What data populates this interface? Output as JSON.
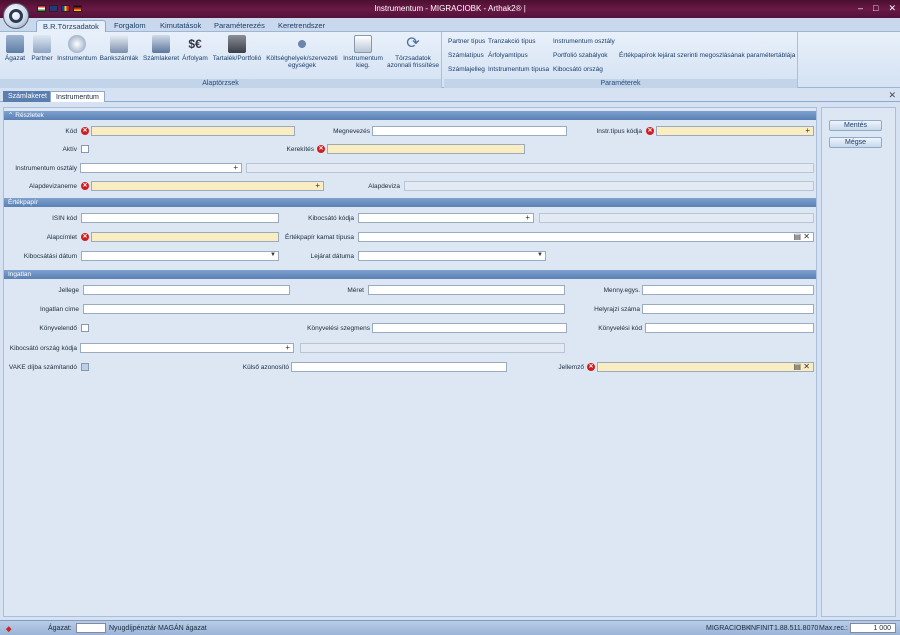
{
  "window": {
    "title": "Instrumentum - MIGRACIOBK - Arthak2® |"
  },
  "menu": {
    "tabs": [
      "B.R.Törzsadatok",
      "Forgalom",
      "Kimutatások",
      "Paraméterezés",
      "Keretrendszer"
    ]
  },
  "ribbon": {
    "alaptorzsek": {
      "label": "Alaptörzsek",
      "buttons": [
        "Ágazat",
        "Partner",
        "Instrumentum",
        "Bankszámlák",
        "Számlakeret",
        "Árfolyam",
        "Tartalék/Portfolió",
        "Költséghelyek/szervezeti egységek",
        "Instrumentum kieg.",
        "Törzsadatok azonnali frissítése"
      ]
    },
    "parameterek": {
      "label": "Paraméterek",
      "col1": [
        "Partner típus",
        "Számlatípus",
        "Számlajelleg"
      ],
      "col2": [
        "Tranzakció típus",
        "Árfolyamtípus",
        "Intstrumentum típusa"
      ],
      "col3": [
        "Instrumentum osztály",
        "Portfolió szabályok",
        "Kibocsátó ország"
      ],
      "col4": [
        "Értékpapírok lejárat szerinti megoszlásának paramétertáblája"
      ]
    }
  },
  "doc_tabs": [
    "Számlakeret",
    "Instrumentum"
  ],
  "sections": {
    "reszletek": "Részletek",
    "ertekpapir": "Értékpapír",
    "ingatlan": "Ingatlan"
  },
  "labels": {
    "kod": "Kód",
    "megnevezes": "Megnevezés",
    "instr_tipus_kodja": "Instr.típus kódja",
    "aktiv": "Aktív",
    "kerekites": "Kerekítés",
    "instrumentum_osztaly": "Instrumentum osztály",
    "alapdevizaneme": "Alapdevizaneme",
    "alapdeviza": "Alapdeviza",
    "isin_kod": "ISIN kód",
    "kibocsato_kodja": "Kibocsátó kódja",
    "alapcimlet": "Alapcímlet",
    "ertekpapir_kamat_tipusa": "Értékpapír kamat típusa",
    "kibocsatasi_datum": "Kibocsátási dátum",
    "lejarat_datuma": "Lejárat dátuma",
    "jellege": "Jellege",
    "meret": "Méret",
    "menny_egys": "Menny.egys.",
    "ingatlan_cime": "Ingatlan címe",
    "helyrajzi_szama": "Helyrajzi száma",
    "konyvelendo": "Könyvelendő",
    "konyvelesi_szegmens": "Könyvelési szegmens",
    "konyvelesi_kod": "Könyvelési kód",
    "kibocsato_orszag_kodja": "Kibocsátó ország kódja",
    "vake_djba": "VAKE díjba számítandó",
    "kulso_azonosito": "Külső azonosító",
    "jellemzo": "Jellemző"
  },
  "side_buttons": {
    "save": "Mentés",
    "cancel": "Mégse"
  },
  "status": {
    "agazat_label": "Ágazat:",
    "agazat_value": "Nyugdíjpénztár MAGÁN ágazat",
    "db": "MIGRACIOBK",
    "mode": "INFINIT",
    "version": "1.88.511.8070",
    "maxrec_label": "Max.rec.:",
    "maxrec_value": "1 000"
  }
}
